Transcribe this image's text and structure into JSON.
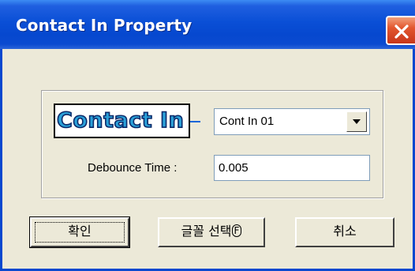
{
  "window": {
    "title": "Contact In Property"
  },
  "widget": {
    "contact_label": "Contact In"
  },
  "fields": {
    "channel_value": "Cont In 01",
    "debounce_label": "Debounce Time :",
    "debounce_value": "0.005"
  },
  "buttons": {
    "ok": "확인",
    "font_select": "글꼴 선택",
    "font_select_mnemonic": "F",
    "cancel": "취소"
  }
}
